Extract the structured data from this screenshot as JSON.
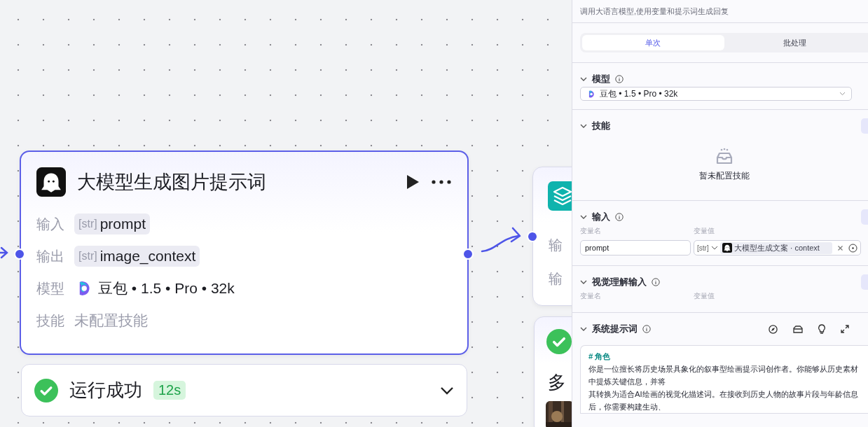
{
  "nodes": [
    {
      "kind": "llm",
      "title": "大模型生成图片提示词",
      "selected": true,
      "rows": [
        {
          "label": "输入",
          "kind": "var",
          "type": "[str]",
          "value": "prompt"
        },
        {
          "label": "输出",
          "kind": "var",
          "type": "[str]",
          "value": "image_context"
        },
        {
          "label": "模型",
          "kind": "model",
          "value": "豆包 • 1.5 • Pro • 32k"
        },
        {
          "label": "技能",
          "kind": "muted",
          "value": "未配置技能"
        }
      ],
      "run": {
        "status": "运行成功",
        "time": "12s"
      }
    },
    {
      "kind": "knowledge",
      "selected": false,
      "rows": [
        {
          "label": "输"
        },
        {
          "label": "输"
        }
      ]
    },
    {
      "kind": "result",
      "selected": false,
      "title": "多"
    }
  ],
  "panel": {
    "description": "调用大语言模型,使用变量和提示词生成回复",
    "tabs": [
      {
        "label": "单次",
        "selected": true
      },
      {
        "label": "批处理",
        "selected": false
      }
    ],
    "sections": [
      {
        "kind": "model",
        "title": "模型",
        "info": true,
        "expanded": true,
        "model": "豆包 • 1.5 • Pro • 32k"
      },
      {
        "kind": "skills",
        "title": "技能",
        "info": false,
        "expanded": true,
        "empty_text": "暂未配置技能"
      },
      {
        "kind": "inputs",
        "title": "输入",
        "info": true,
        "expanded": true,
        "columns": [
          "变量名",
          "变量值"
        ],
        "rows": [
          {
            "name": "prompt",
            "type": "[str]",
            "source": "大模型生成文案 · context"
          }
        ]
      },
      {
        "kind": "inputs",
        "title": "视觉理解输入",
        "info": true,
        "expanded": true,
        "columns": [
          "变量名",
          "变量值"
        ]
      },
      {
        "kind": "prompt",
        "title": "系统提示词",
        "info": true,
        "expanded": true,
        "heading": "# 角色",
        "lines": [
          "你是一位擅长将历史场景具象化的叙事型绘画提示词创作者。你能够从历史素材中提炼关键信息，并将",
          "其转换为适合AI绘画的视觉化描述词。在接收到历史人物的故事片段与年龄信息后，你需要构建生动、"
        ]
      }
    ]
  }
}
